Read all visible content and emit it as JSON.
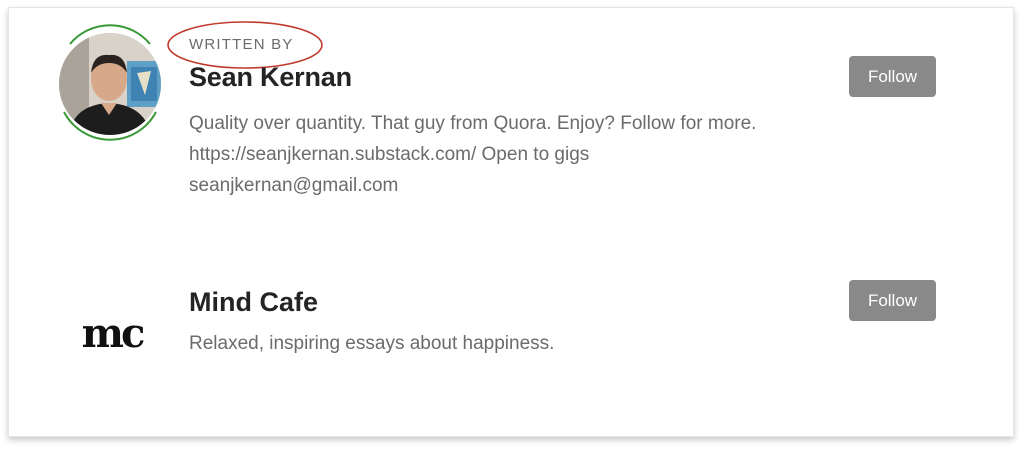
{
  "author": {
    "label": "WRITTEN BY",
    "name": "Sean Kernan",
    "bio": "Quality over quantity. That guy from Quora. Enjoy? Follow for more. https://seanjkernan.substack.com/ Open to gigs seanjkernan@gmail.com",
    "follow_label": "Follow",
    "ring_color": "#3a9a3a",
    "annotation_color": "#c0392b"
  },
  "publication": {
    "logo_text": "mc",
    "name": "Mind Cafe",
    "description": "Relaxed, inspiring essays about happiness.",
    "follow_label": "Follow"
  },
  "colors": {
    "button_bg": "#898989",
    "heading": "#242424",
    "muted": "#6b6b6b"
  }
}
